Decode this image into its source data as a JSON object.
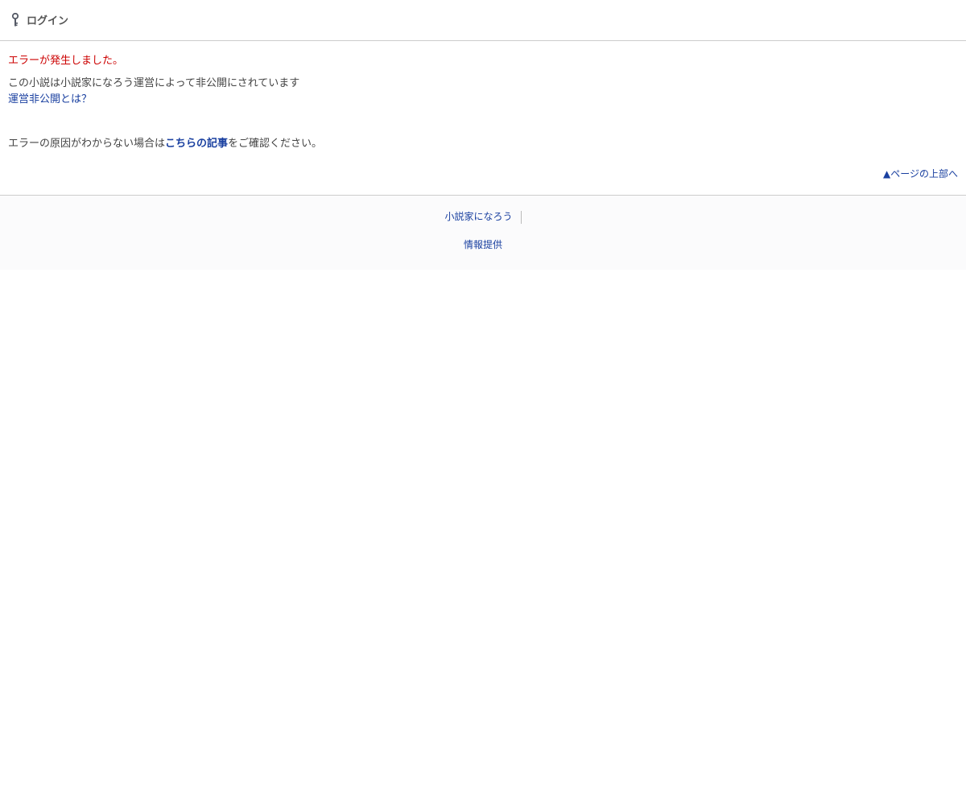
{
  "header": {
    "login_label": "ログイン"
  },
  "main": {
    "error_title": "エラーが発生しました。",
    "error_message": "この小説は小説家になろう運営によって非公開にされています",
    "help_link_label": "運営非公開とは？",
    "cause_prefix": "エラーの原因がわからない場合は",
    "cause_link_label": "こちらの記事",
    "cause_suffix": "をご確認ください。",
    "page_top_label": "▲ページの上部へ"
  },
  "footer": {
    "site_link_label": "小説家になろう",
    "info_link_label": "情報提供"
  },
  "colors": {
    "error_red": "#cc0000",
    "link_blue": "#1a40a0",
    "text_gray": "#444444",
    "footer_bg": "#fbfbfc"
  },
  "icons": {
    "login_icon": "key-icon"
  }
}
